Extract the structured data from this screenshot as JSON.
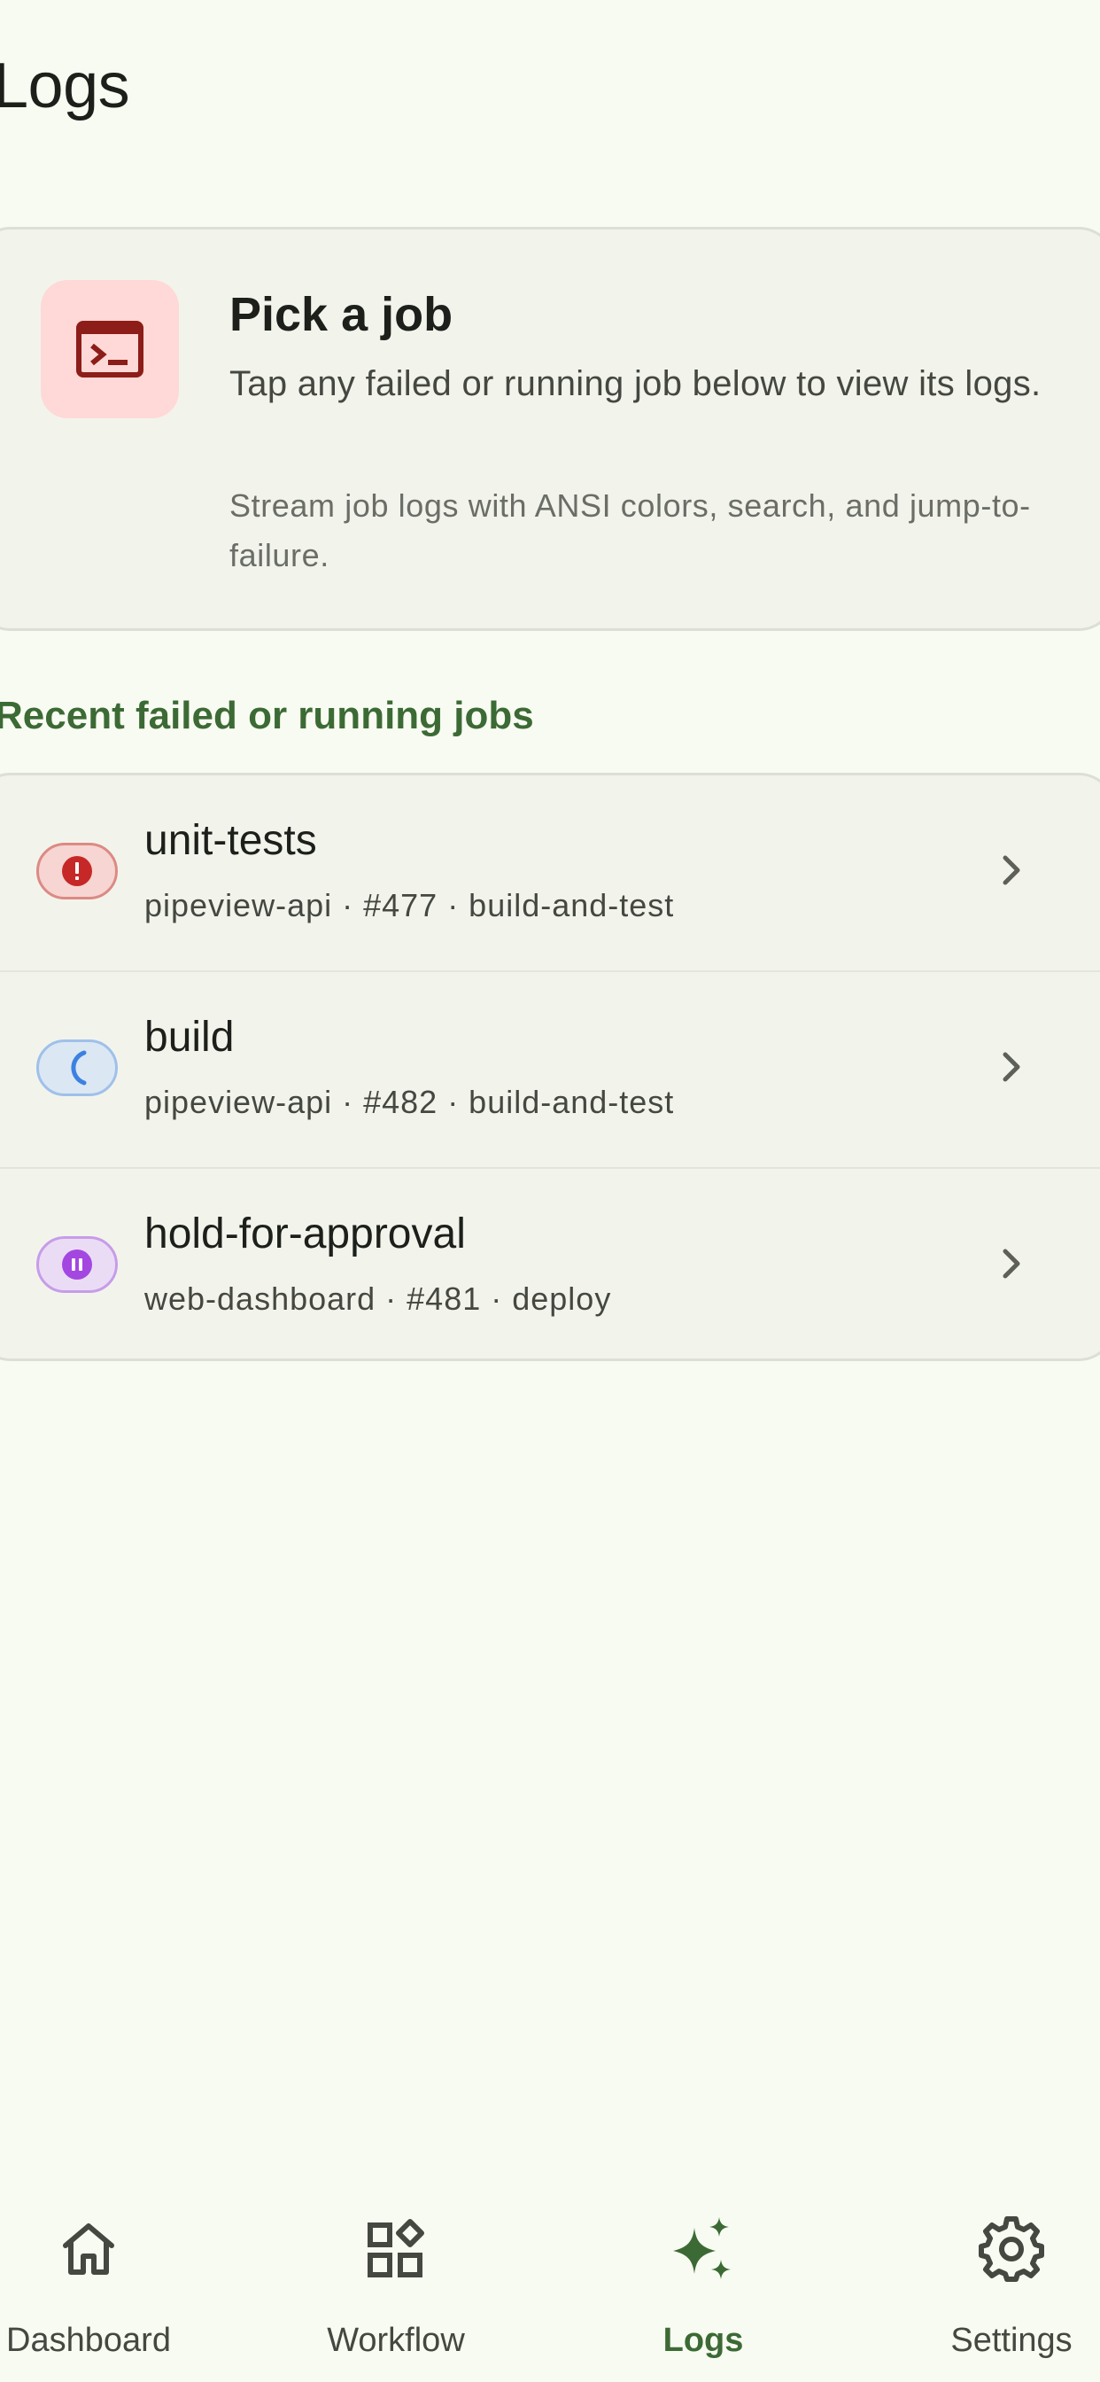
{
  "page": {
    "title": "Logs"
  },
  "info_card": {
    "icon": "terminal-icon",
    "title": "Pick a job",
    "description": "Tap any failed or running job below to view its logs.",
    "hint": "Stream job logs with ANSI colors, search, and jump-to-failure."
  },
  "section": {
    "title": "Recent failed or running jobs"
  },
  "jobs": [
    {
      "name": "unit-tests",
      "meta": "pipeview-api · #477 · build-and-test",
      "status": "failed",
      "status_icon": "error-icon"
    },
    {
      "name": "build",
      "meta": "pipeview-api · #482 · build-and-test",
      "status": "running",
      "status_icon": "spinner-icon"
    },
    {
      "name": "hold-for-approval",
      "meta": "web-dashboard · #481 · deploy",
      "status": "waiting",
      "status_icon": "pause-icon"
    }
  ],
  "nav": {
    "items": [
      {
        "label": "Dashboard",
        "icon": "home-icon"
      },
      {
        "label": "Workflow",
        "icon": "widgets-icon"
      },
      {
        "label": "Logs",
        "icon": "sparkle-icon",
        "active": true
      },
      {
        "label": "Settings",
        "icon": "gear-icon"
      }
    ]
  },
  "colors": {
    "background": "#f8fbf1",
    "card": "#f2f4ec",
    "accent": "#3c6a35",
    "failed": "#c62828",
    "running": "#3b82e0",
    "waiting": "#a447e0"
  }
}
